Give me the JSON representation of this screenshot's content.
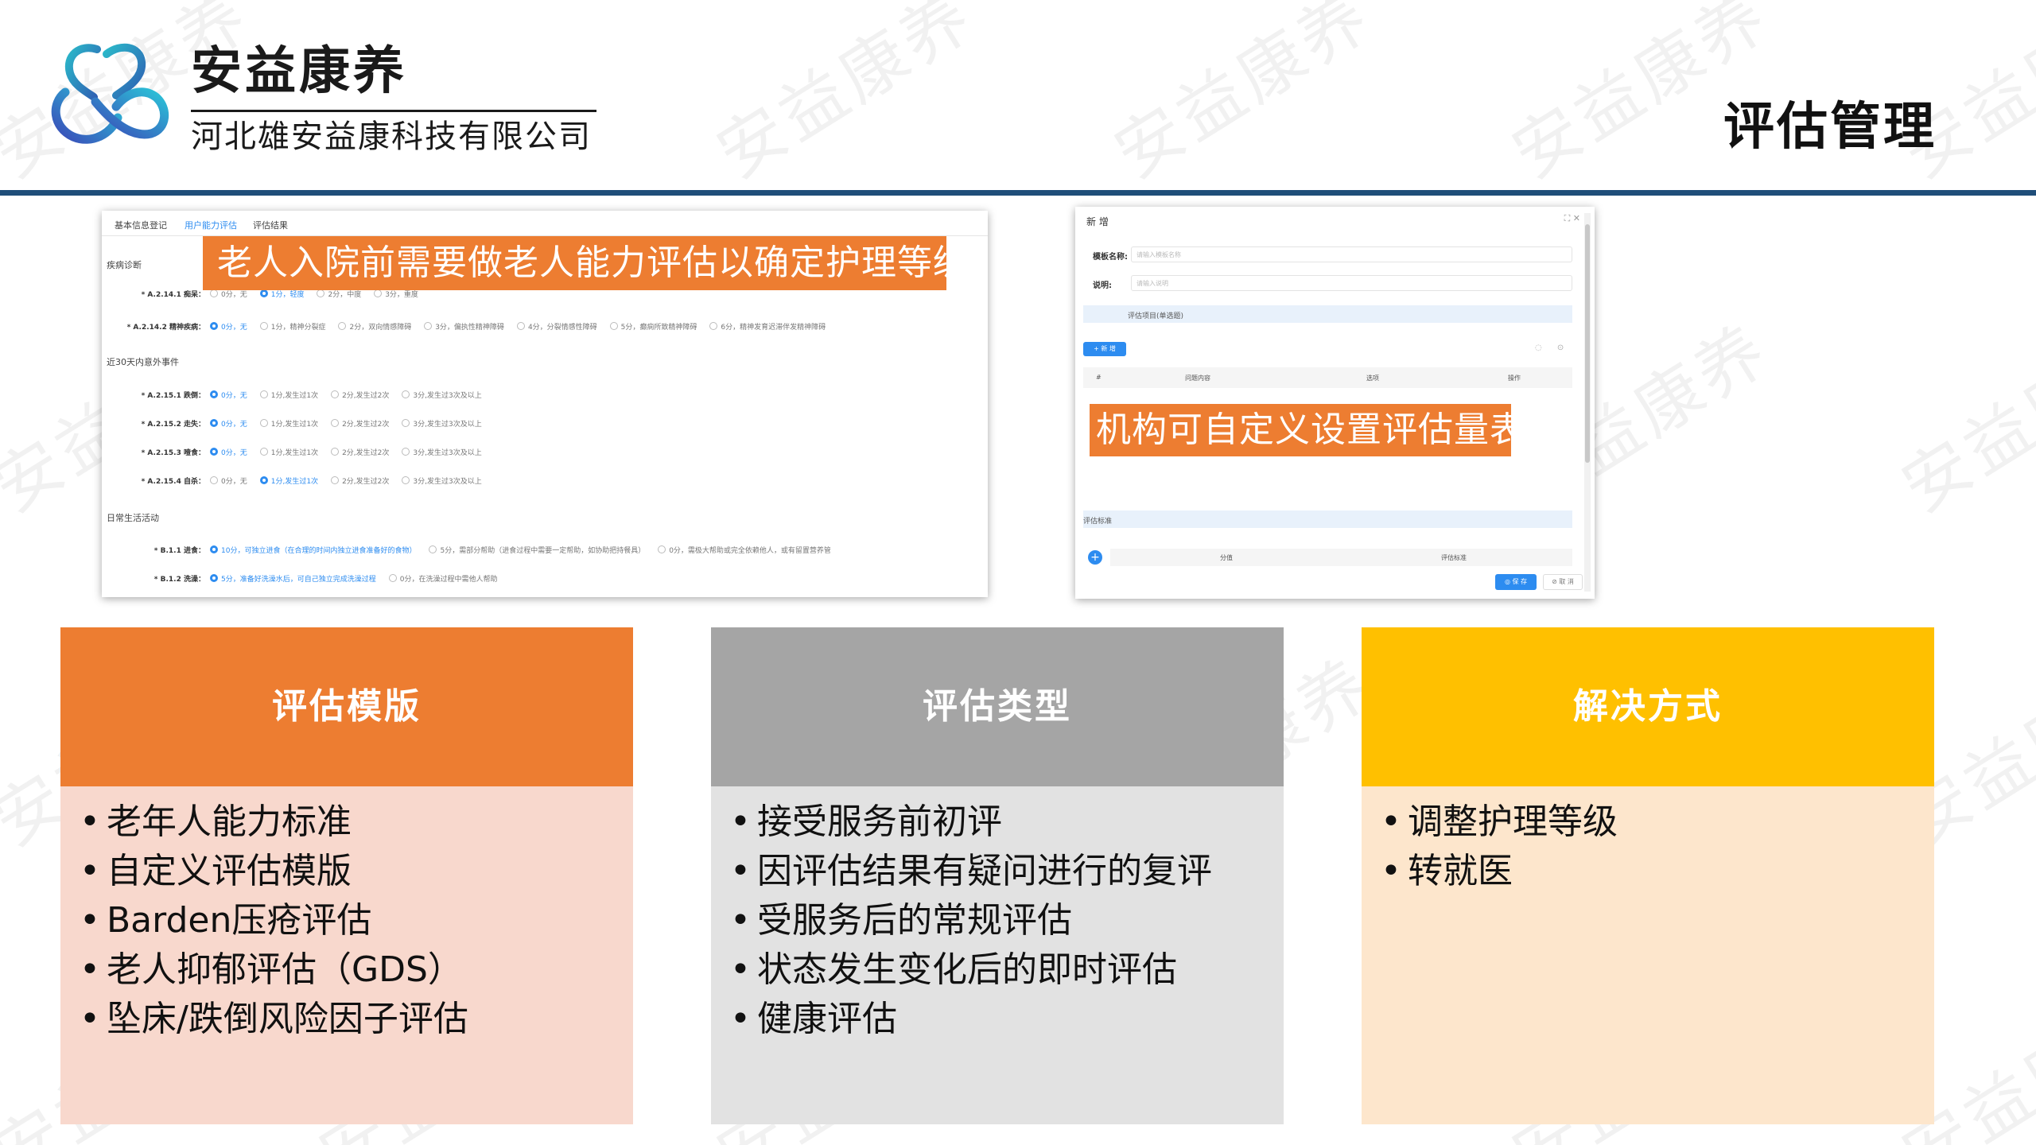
{
  "header": {
    "company_name": "安益康养",
    "company_full": "河北雄安益康科技有限公司",
    "page_title": "评估管理",
    "accent_color": "#1f4e79"
  },
  "watermark": "安益康养",
  "shot1": {
    "tabs": [
      "基本信息登记",
      "用户能力评估",
      "评估结果"
    ],
    "sections": [
      "疾病诊断",
      "近30天内意外事件",
      "日常生活活动"
    ],
    "questions": [
      {
        "label": "* A.2.14.1 痴呆：",
        "options": [
          "0分，无",
          "1分，轻度",
          "2分，中度",
          "3分，重度"
        ],
        "selected": 1
      },
      {
        "label": "* A.2.14.2 精神疾病：",
        "options": [
          "0分，无",
          "1分，精神分裂症",
          "2分，双向情感障碍",
          "3分，偏执性精神障碍",
          "4分，分裂情感性障碍",
          "5分，癫痫所致精神障碍",
          "6分，精神发育迟滞伴发精神障碍"
        ],
        "selected": 0
      },
      {
        "label": "* A.2.15.1 跌倒：",
        "options": [
          "0分，无",
          "1分,发生过1次",
          "2分,发生过2次",
          "3分,发生过3次及以上"
        ],
        "selected": 0
      },
      {
        "label": "* A.2.15.2 走失：",
        "options": [
          "0分，无",
          "1分,发生过1次",
          "2分,发生过2次",
          "3分,发生过3次及以上"
        ],
        "selected": 0
      },
      {
        "label": "* A.2.15.3 噎食：",
        "options": [
          "0分，无",
          "1分,发生过1次",
          "2分,发生过2次",
          "3分,发生过3次及以上"
        ],
        "selected": 0
      },
      {
        "label": "* A.2.15.4 自杀：",
        "options": [
          "0分，无",
          "1分,发生过1次",
          "2分,发生过2次",
          "3分,发生过3次及以上"
        ],
        "selected": 1
      },
      {
        "label": "* B.1.1 进食：",
        "options": [
          "10分，可独立进食（在合理的时间内独立进食准备好的食物）",
          "5分，需部分帮助（进食过程中需要一定帮助，如协助把持餐具）",
          "0分，需极大帮助或完全依赖他人，或有留置营养管"
        ],
        "selected": 0
      },
      {
        "label": "* B.1.2 洗澡：",
        "options": [
          "5分，准备好洗澡水后，可自己独立完成洗澡过程",
          "0分，在洗澡过程中需他人帮助"
        ],
        "selected": 0
      }
    ],
    "callout": "老人入院前需要做老人能力评估以确定护理等级"
  },
  "shot2": {
    "title": "新 增",
    "window_icons": "⛶ ✕",
    "name_label": "模板名称:",
    "name_placeholder": "请输入模板名称",
    "desc_label": "说明:",
    "desc_placeholder": "请输入说明",
    "items_band": "评估项目(单选题)",
    "add_button": "+ 新 增",
    "tool_icons": "◌ ⊙",
    "table_headers": [
      "#",
      "问题内容",
      "选项",
      "操作"
    ],
    "standard_band": "评估标准",
    "add_icon": "+",
    "standard_headers": [
      "分值",
      "评估标准"
    ],
    "save_button": "◎ 保 存",
    "cancel_button": "⊘ 取 消",
    "callout": "机构可自定义设置评估量表"
  },
  "cards": [
    {
      "title": "评估模版",
      "items": [
        "老年人能力标准",
        "自定义评估模版",
        "Barden压疮评估",
        "老人抑郁评估（GDS）",
        "坠床/跌倒风险因子评估"
      ],
      "color": "#ed7d31"
    },
    {
      "title": "评估类型",
      "items": [
        "接受服务前初评",
        "因评估结果有疑问进行的复评",
        "受服务后的常规评估",
        "状态发生变化后的即时评估",
        "健康评估"
      ],
      "color": "#a5a5a5"
    },
    {
      "title": "解决方式",
      "items": [
        "调整护理等级",
        "转就医"
      ],
      "color": "#ffc000"
    }
  ]
}
